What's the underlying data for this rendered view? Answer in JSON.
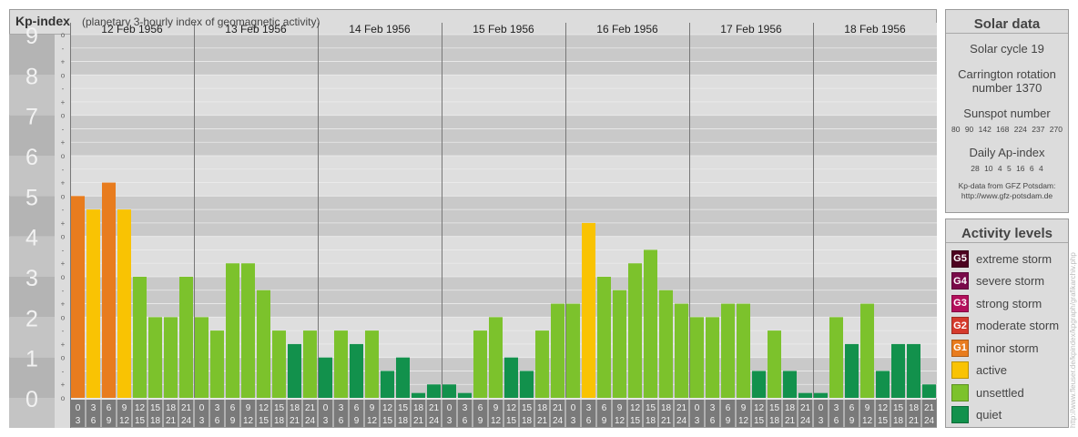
{
  "chart_data": {
    "type": "bar",
    "title": "Kp-index",
    "subtitle": "(planetary 3-hourly index of geomagnetic activity)",
    "ylim": [
      0,
      9
    ],
    "y_ticks": [
      "0",
      "1",
      "2",
      "3",
      "4",
      "5",
      "6",
      "7",
      "8",
      "9"
    ],
    "y_minor_ticks": [
      "o",
      "+",
      "-"
    ],
    "days": [
      "12 Feb 1956",
      "13 Feb 1956",
      "14 Feb 1956",
      "15 Feb 1956",
      "16 Feb 1956",
      "17 Feb 1956",
      "18 Feb 1956"
    ],
    "interval_top": [
      "0",
      "3",
      "6",
      "9",
      "12",
      "15",
      "18",
      "21"
    ],
    "interval_bottom": [
      "3",
      "6",
      "9",
      "12",
      "15",
      "18",
      "21",
      "24"
    ],
    "values": [
      [
        5.0,
        4.667,
        5.333,
        4.667,
        3.0,
        2.0,
        2.0,
        3.0
      ],
      [
        2.0,
        1.667,
        3.333,
        3.333,
        2.667,
        1.667,
        1.333,
        1.667
      ],
      [
        1.0,
        1.667,
        1.333,
        1.667,
        0.667,
        1.0,
        0.0,
        0.333
      ],
      [
        0.333,
        0.0,
        1.667,
        2.0,
        1.0,
        0.667,
        1.667,
        2.333
      ],
      [
        2.333,
        4.333,
        3.0,
        2.667,
        3.333,
        3.667,
        2.667,
        2.333
      ],
      [
        2.0,
        2.0,
        2.333,
        2.333,
        0.667,
        1.667,
        0.667,
        0.0
      ],
      [
        0.0,
        2.0,
        1.333,
        2.333,
        0.667,
        1.333,
        1.333,
        0.333
      ]
    ],
    "colors": {
      "quiet": "#12914c",
      "unsettled": "#7cc22c",
      "active": "#f9c303",
      "minor": "#e87c1e",
      "moderate": "#d53a2c",
      "strong": "#b3105b",
      "severe": "#7a0a4a",
      "extreme": "#4d0320"
    }
  },
  "solar": {
    "title": "Solar data",
    "cycle": "Solar cycle 19",
    "carrington_line1": "Carrington rotation",
    "carrington_line2": "number 1370",
    "sunspot_label": "Sunspot number",
    "sunspot_values": "80 90 142 168 224 237 270",
    "ap_label": "Daily Ap-index",
    "ap_values": "28 10 4 5 16 6 4",
    "credit_line1": "Kp-data from GFZ Potsdam:",
    "credit_line2": "http://www.gfz-potsdam.de"
  },
  "activity": {
    "title": "Activity levels",
    "levels": [
      {
        "code": "G5",
        "label": "extreme storm",
        "color": "#4d0320"
      },
      {
        "code": "G4",
        "label": "severe storm",
        "color": "#7a0a4a"
      },
      {
        "code": "G3",
        "label": "strong storm",
        "color": "#b3105b"
      },
      {
        "code": "G2",
        "label": "moderate storm",
        "color": "#d53a2c"
      },
      {
        "code": "G1",
        "label": "minor storm",
        "color": "#e87c1e"
      },
      {
        "code": "",
        "label": "active",
        "color": "#f9c303"
      },
      {
        "code": "",
        "label": "unsettled",
        "color": "#7cc22c"
      },
      {
        "code": "",
        "label": "quiet",
        "color": "#12914c"
      }
    ]
  },
  "watermark": "http://www.fleuser.de/kpindex/kpgraph/grafikarchiv.php"
}
